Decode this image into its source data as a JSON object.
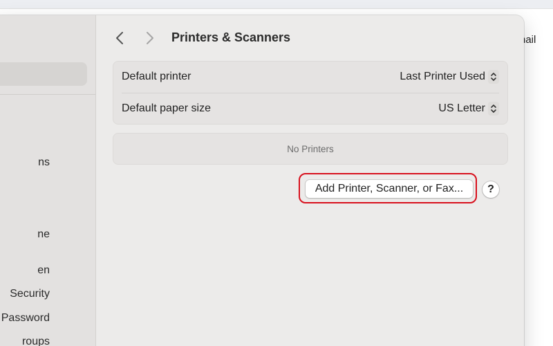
{
  "background_app": {
    "partial_text": "nail"
  },
  "sidebar": {
    "items": [
      {
        "label": "ns"
      },
      {
        "label": "ne"
      },
      {
        "label": "en"
      },
      {
        "label": "Security"
      },
      {
        "label": "& Password"
      },
      {
        "label": "roups"
      }
    ]
  },
  "header": {
    "title": "Printers & Scanners",
    "back_icon": "chevron-left-icon",
    "forward_icon": "chevron-right-icon"
  },
  "settings": {
    "default_printer": {
      "label": "Default printer",
      "value": "Last Printer Used"
    },
    "default_paper_size": {
      "label": "Default paper size",
      "value": "US Letter"
    }
  },
  "printers": {
    "empty_text": "No Printers"
  },
  "actions": {
    "add_label": "Add Printer, Scanner, or Fax...",
    "help_label": "?"
  },
  "colors": {
    "highlight": "#d8101d"
  }
}
